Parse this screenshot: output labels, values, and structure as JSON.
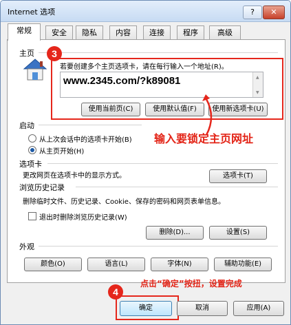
{
  "window": {
    "title": "Internet 选项",
    "help_label": "?",
    "close_label": "✕"
  },
  "tabs": [
    "常规",
    "安全",
    "隐私",
    "内容",
    "连接",
    "程序",
    "高级"
  ],
  "home": {
    "section": "主页",
    "instruction": "若要创建多个主页选项卡，请在每行输入一个地址(R)。",
    "url": "www.2345.com/?k89081",
    "use_current": "使用当前页(C)",
    "use_default": "使用默认值(F)",
    "use_new_tab": "使用新选项卡(U)"
  },
  "startup": {
    "section": "启动",
    "option_last": "从上次会话中的选项卡开始(B)",
    "option_home": "从主页开始(H)",
    "selected": "option_home"
  },
  "tabs_section": {
    "section": "选项卡",
    "description": "更改网页在选项卡中的显示方式。",
    "button": "选项卡(T)"
  },
  "history": {
    "section": "浏览历史记录",
    "description": "删除临时文件、历史记录、Cookie、保存的密码和网页表单信息。",
    "checkbox": "退出时删除浏览历史记录(W)",
    "checked": false,
    "delete_button": "删除(D)...",
    "settings_button": "设置(S)"
  },
  "appearance": {
    "section": "外观",
    "colors": "颜色(O)",
    "languages": "语言(L)",
    "fonts": "字体(N)",
    "accessibility": "辅助功能(E)"
  },
  "annotations": {
    "step3": "3",
    "step4": "4",
    "lock_homepage": "输入要锁定主页网址",
    "click_ok": "点击“确定”按扭，设置完成",
    "accent": "#e5261b"
  },
  "footer": {
    "ok": "确定",
    "cancel": "取消",
    "apply": "应用(A)"
  }
}
